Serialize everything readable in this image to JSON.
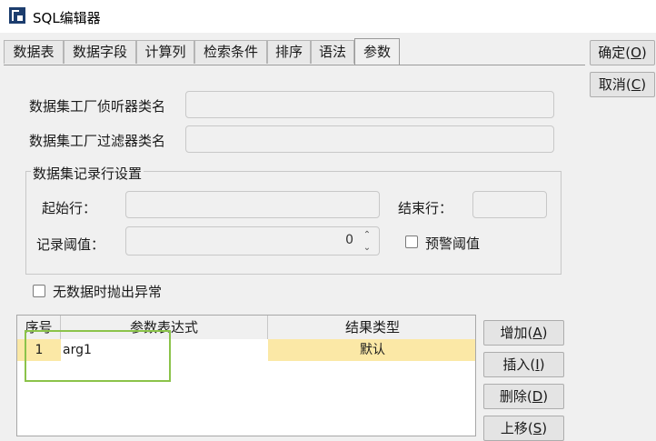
{
  "window": {
    "title": "SQL编辑器"
  },
  "tabs": [
    {
      "label": "数据表"
    },
    {
      "label": "数据字段"
    },
    {
      "label": "计算列"
    },
    {
      "label": "检索条件"
    },
    {
      "label": "排序"
    },
    {
      "label": "语法"
    },
    {
      "label": "参数"
    }
  ],
  "active_tab": "参数",
  "form": {
    "listener_label": "数据集工厂侦听器类名",
    "listener_value": "",
    "filter_label": "数据集工厂过滤器类名",
    "filter_value": "",
    "row_group": {
      "title": "数据集记录行设置",
      "start_label": "起始行：",
      "start_value": "",
      "end_label": "结束行：",
      "end_value": "",
      "threshold_label": "记录阈值：",
      "threshold_value": "0",
      "warn_label": "预警阈值"
    },
    "throw_label": "无数据时抛出异常"
  },
  "param_table": {
    "columns": [
      "序号",
      "参数表达式",
      "结果类型"
    ],
    "rows": [
      {
        "index": "1",
        "expression": "arg1",
        "type": "默认"
      }
    ]
  },
  "side_buttons": {
    "ok": {
      "text": "确定(",
      "acc": "O",
      "end": ")"
    },
    "cancel": {
      "text": "取消(",
      "acc": "C",
      "end": ")"
    }
  },
  "table_buttons": {
    "add": {
      "text": "增加(",
      "acc": "A",
      "end": ")"
    },
    "insert": {
      "text": "插入(",
      "acc": "I",
      "end": ")"
    },
    "delete": {
      "text": "删除(",
      "acc": "D",
      "end": ")"
    },
    "move_up": {
      "text": "上移(",
      "acc": "S",
      "end": ")"
    }
  },
  "colors": {
    "selected_row": "#fbe8a6",
    "highlight_box": "#8bc34a"
  }
}
